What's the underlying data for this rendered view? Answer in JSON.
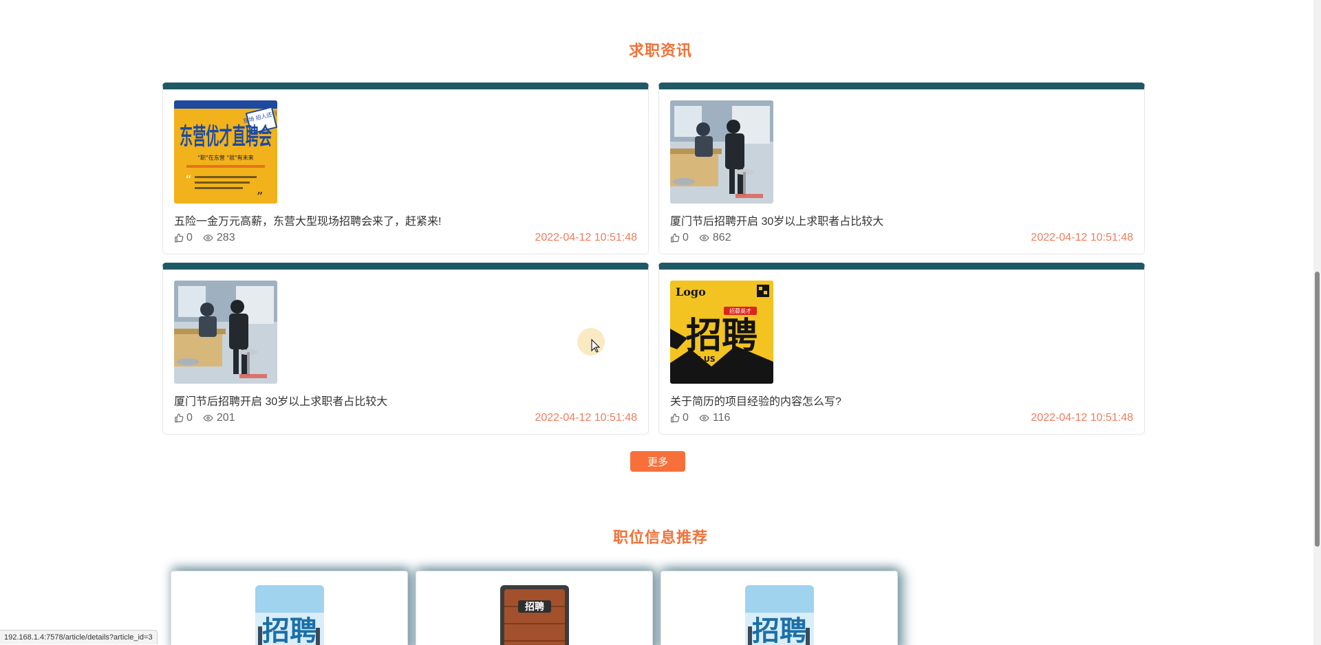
{
  "sections": {
    "news_title": "求职资讯",
    "jobs_title": "职位信息推荐"
  },
  "news": [
    {
      "title": "五险一金万元高薪，东营大型现场招聘会来了，赶紧来!",
      "likes": "0",
      "views": "283",
      "date": "2022-04-12 10:51:48",
      "image": {
        "kind": "poster-yellow",
        "top_text": "东营优才直聘会",
        "line2": "\"职\"在东营 \"就\"有未来",
        "badge": "现场 招人还行"
      }
    },
    {
      "title": "厦门节后招聘开启 30岁以上求职者占比较大",
      "likes": "0",
      "views": "862",
      "date": "2022-04-12 10:51:48",
      "image": {
        "kind": "photo-office"
      }
    },
    {
      "title": "厦门节后招聘开启 30岁以上求职者占比较大",
      "likes": "0",
      "views": "201",
      "date": "2022-04-12 10:51:48",
      "image": {
        "kind": "photo-office"
      }
    },
    {
      "title": "关于简历的项目经验的内容怎么写?",
      "likes": "0",
      "views": "116",
      "date": "2022-04-12 10:51:48",
      "image": {
        "kind": "poster-zhaopin",
        "logo": "Logo",
        "big": "招聘",
        "small": "JOIN US",
        "tag": "招募英才"
      }
    }
  ],
  "more_button": "更多",
  "jobs": [
    {
      "image": {
        "kind": "zhaopin-blue",
        "text": "招聘"
      }
    },
    {
      "image": {
        "kind": "zhaopin-wood",
        "text": "招聘"
      }
    },
    {
      "image": {
        "kind": "zhaopin-blue",
        "text": "招聘"
      }
    }
  ],
  "status_bar": {
    "url": "192.168.1.4:7578/article/details?article_id=3"
  },
  "colors": {
    "accent": "#f07238",
    "card_top": "#1f5966",
    "date": "#f07c5a",
    "button": "#f7703a"
  },
  "icons": {
    "like": "thumbs-up-icon",
    "views": "eye-icon"
  }
}
